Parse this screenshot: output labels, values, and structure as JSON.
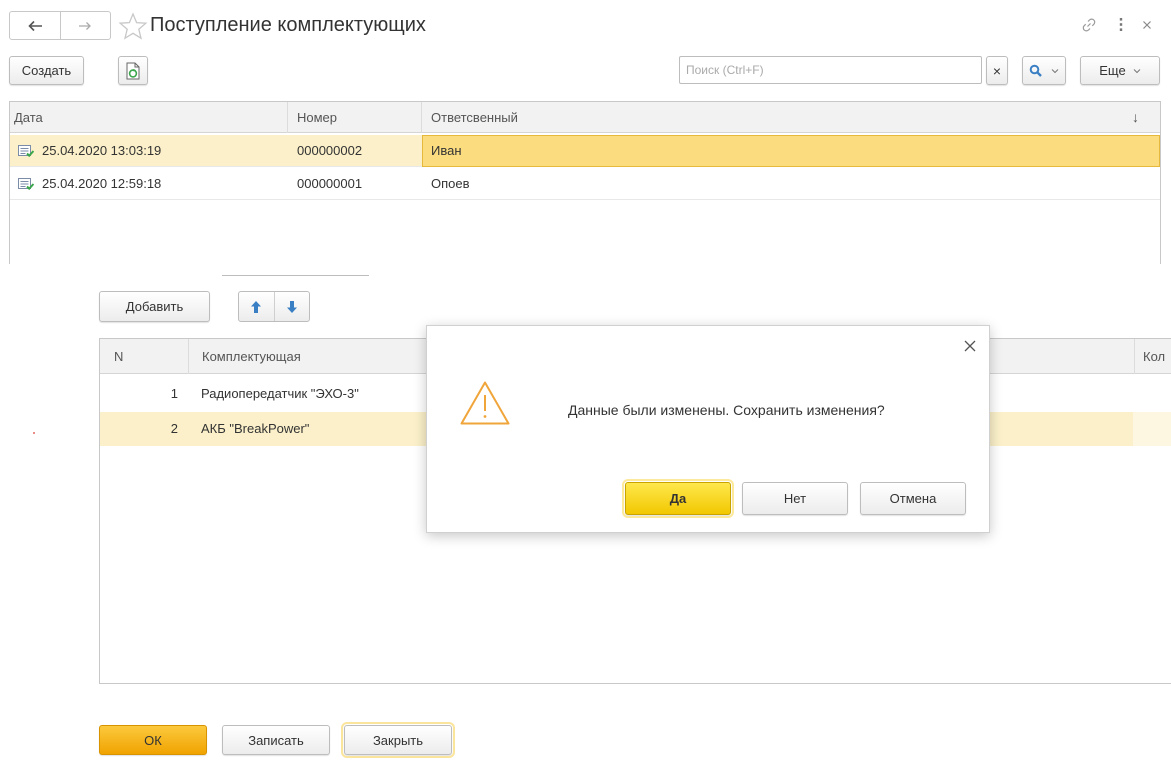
{
  "window": {
    "title": "Поступление комплектующих"
  },
  "toolbar": {
    "create_label": "Создать",
    "search_placeholder": "Поиск (Ctrl+F)",
    "search_clear_label": "×",
    "more_label": "Еще"
  },
  "list": {
    "columns": {
      "date": "Дата",
      "number": "Номер",
      "responsible": "Ответсвенный",
      "sort_indicator": "↓"
    },
    "rows": [
      {
        "date": "25.04.2020 13:03:19",
        "number": "000000002",
        "responsible": "Иван",
        "selected": true
      },
      {
        "date": "25.04.2020 12:59:18",
        "number": "000000001",
        "responsible": "Опоев",
        "selected": false
      }
    ]
  },
  "form": {
    "add_label": "Добавить",
    "columns": {
      "n": "N",
      "component": "Комплектующая",
      "quantity_partial": "Кол"
    },
    "rows": [
      {
        "n": "1",
        "component": "Радиопередатчик \"ЭХО-3\"",
        "selected": false
      },
      {
        "n": "2",
        "component": "АКБ \"BreakPower\"",
        "selected": true
      }
    ]
  },
  "dialog": {
    "message": "Данные были изменены. Сохранить изменения?",
    "yes_label": "Да",
    "no_label": "Нет",
    "cancel_label": "Отмена"
  },
  "footer": {
    "ok_label": "ОК",
    "save_label": "Записать",
    "close_label": "Закрыть"
  },
  "colors": {
    "selected_row": "#fbf0c9",
    "focused_cell": "#fbdd80",
    "ok_button": "#f5b300",
    "yes_button": "#f8d91a",
    "accent_blue": "#3a7fc4",
    "warning": "#f0a53a"
  }
}
